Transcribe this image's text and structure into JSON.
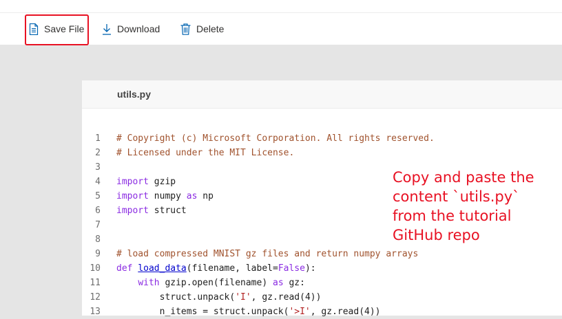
{
  "toolbar": {
    "save_label": "Save File",
    "download_label": "Download",
    "delete_label": "Delete",
    "highlight_color": "#e81123"
  },
  "editor": {
    "tab_title": "utils.py",
    "lines": [
      {
        "num": "1",
        "tokens": [
          {
            "t": "comment",
            "v": "# Copyright (c) Microsoft Corporation. All rights reserved."
          }
        ]
      },
      {
        "num": "2",
        "tokens": [
          {
            "t": "comment",
            "v": "# Licensed under the MIT License."
          }
        ]
      },
      {
        "num": "3",
        "tokens": []
      },
      {
        "num": "4",
        "tokens": [
          {
            "t": "keyword",
            "v": "import"
          },
          {
            "t": "plain",
            "v": " gzip"
          }
        ]
      },
      {
        "num": "5",
        "tokens": [
          {
            "t": "keyword",
            "v": "import"
          },
          {
            "t": "plain",
            "v": " numpy "
          },
          {
            "t": "keyword",
            "v": "as"
          },
          {
            "t": "plain",
            "v": " np"
          }
        ]
      },
      {
        "num": "6",
        "tokens": [
          {
            "t": "keyword",
            "v": "import"
          },
          {
            "t": "plain",
            "v": " struct"
          }
        ]
      },
      {
        "num": "7",
        "tokens": []
      },
      {
        "num": "8",
        "tokens": []
      },
      {
        "num": "9",
        "tokens": [
          {
            "t": "comment",
            "v": "# load compressed MNIST gz files and return numpy arrays"
          }
        ]
      },
      {
        "num": "10",
        "tokens": [
          {
            "t": "keyword",
            "v": "def"
          },
          {
            "t": "plain",
            "v": " "
          },
          {
            "t": "func",
            "v": "load_data"
          },
          {
            "t": "plain",
            "v": "(filename, label="
          },
          {
            "t": "const",
            "v": "False"
          },
          {
            "t": "plain",
            "v": "):"
          }
        ]
      },
      {
        "num": "11",
        "tokens": [
          {
            "t": "plain",
            "v": "    "
          },
          {
            "t": "keyword",
            "v": "with"
          },
          {
            "t": "plain",
            "v": " gzip.open(filename) "
          },
          {
            "t": "keyword",
            "v": "as"
          },
          {
            "t": "plain",
            "v": " gz:"
          }
        ]
      },
      {
        "num": "12",
        "tokens": [
          {
            "t": "plain",
            "v": "        struct.unpack("
          },
          {
            "t": "string",
            "v": "'I'"
          },
          {
            "t": "plain",
            "v": ", gz.read(4))"
          }
        ]
      },
      {
        "num": "13",
        "tokens": [
          {
            "t": "plain",
            "v": "        n_items = struct.unpack("
          },
          {
            "t": "string",
            "v": "'>I'"
          },
          {
            "t": "plain",
            "v": ", gz.read(4))"
          }
        ]
      }
    ]
  },
  "annotation": {
    "lines": [
      "Copy and paste the",
      "content `utils.py`",
      "from the tutorial",
      "GitHub repo"
    ],
    "color": "#e81123"
  }
}
